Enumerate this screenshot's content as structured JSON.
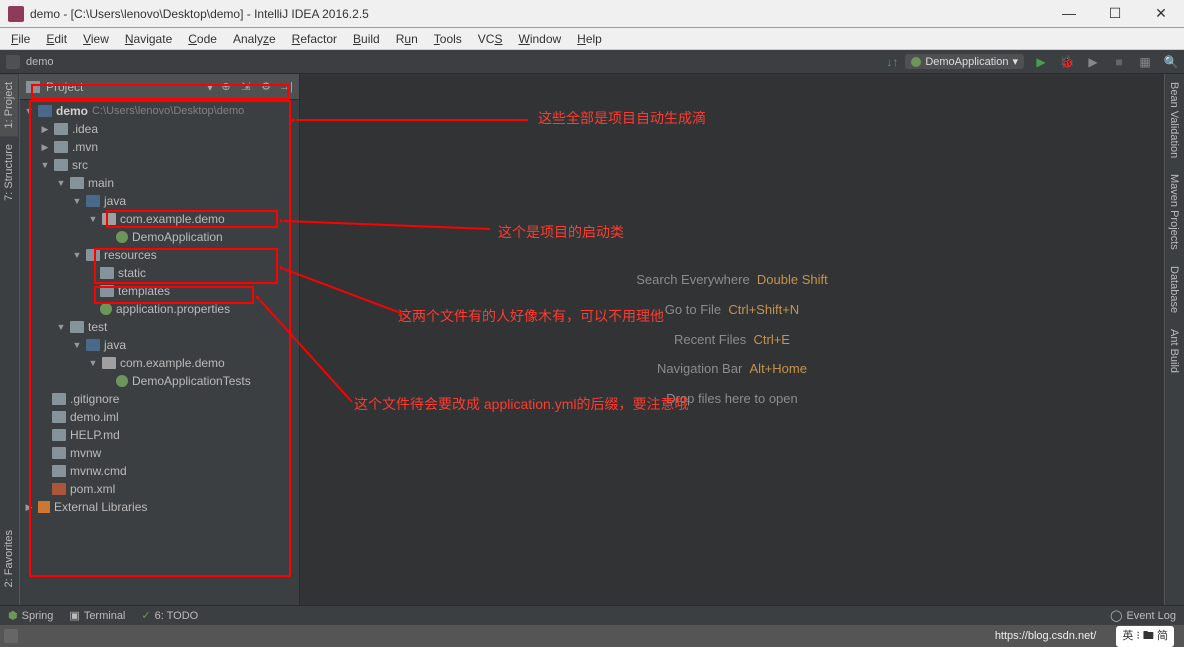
{
  "title": "demo - [C:\\Users\\lenovo\\Desktop\\demo] - IntelliJ IDEA 2016.2.5",
  "menu": [
    "File",
    "Edit",
    "View",
    "Navigate",
    "Code",
    "Analyze",
    "Refactor",
    "Build",
    "Run",
    "Tools",
    "VCS",
    "Window",
    "Help"
  ],
  "breadcrumb": "demo",
  "run_config": "DemoApplication",
  "side_left": [
    {
      "label": "1: Project",
      "active": true
    },
    {
      "label": "7: Structure"
    },
    {
      "label": "2: Favorites"
    }
  ],
  "side_right": [
    "Bean Validation",
    "Maven Projects",
    "Database",
    "Ant Build"
  ],
  "project_panel": {
    "title": "Project"
  },
  "tree": {
    "root": {
      "label": "demo",
      "path": "C:\\Users\\lenovo\\Desktop\\demo"
    },
    "idea": ".idea",
    "mvn": ".mvn",
    "src": "src",
    "main": "main",
    "java1": "java",
    "pkg1": "com.example.demo",
    "cls1": "DemoApplication",
    "res": "resources",
    "static": "static",
    "templates": "templates",
    "appprops": "application.properties",
    "test": "test",
    "java2": "java",
    "pkg2": "com.example.demo",
    "cls2": "DemoApplicationTests",
    "gitignore": ".gitignore",
    "demoiml": "demo.iml",
    "helpmd": "HELP.md",
    "mvnw": "mvnw",
    "mvnwcmd": "mvnw.cmd",
    "pomxml": "pom.xml",
    "extlib": "External Libraries"
  },
  "empty": {
    "l1a": "Search Everywhere",
    "l1b": "Double Shift",
    "l2a": "Go to File",
    "l2b": "Ctrl+Shift+N",
    "l3a": "Recent Files",
    "l3b": "Ctrl+E",
    "l4a": "Navigation Bar",
    "l4b": "Alt+Home",
    "l5": "Drop files here to open"
  },
  "annot": {
    "a1": "这些全部是项目自动生成滴",
    "a2": "这个是项目的启动类",
    "a3": "这两个文件有的人好像木有，可以不用理他",
    "a4": "这个文件待会要改成 application.yml的后缀，要注意哦"
  },
  "status": {
    "spring": "Spring",
    "terminal": "Terminal",
    "todo": "6: TODO",
    "eventlog": "Event Log"
  },
  "watermark": "https://blog.csdn.net/",
  "wm_right": "英 ⁝ 🖿 简"
}
